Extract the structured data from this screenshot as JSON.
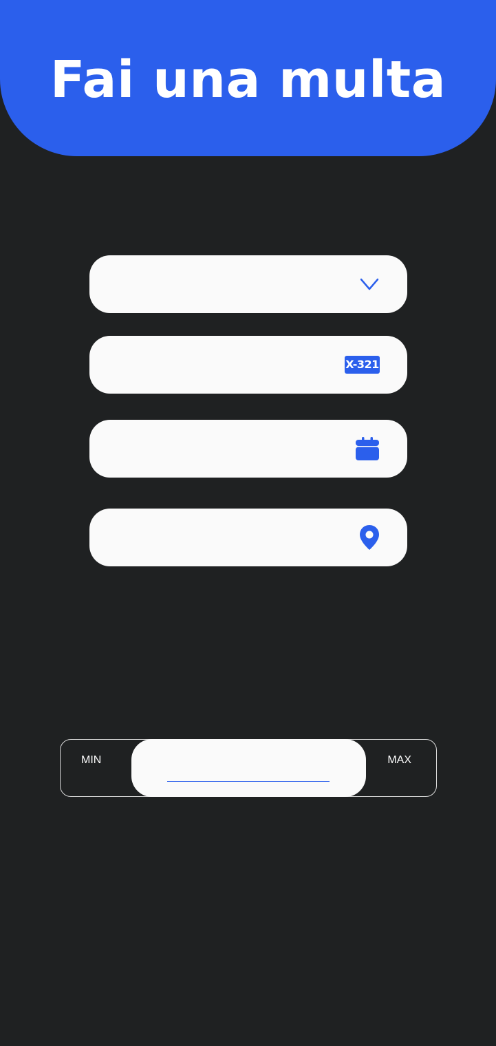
{
  "header": {
    "title": "Fai una multa"
  },
  "form": {
    "violation_type": {
      "value": "",
      "icon": "chevron-down-icon"
    },
    "plate": {
      "value": "",
      "icon": "license-plate-icon",
      "icon_text": "X-321"
    },
    "date": {
      "value": "",
      "icon": "calendar-icon"
    },
    "location": {
      "value": "",
      "icon": "map-pin-icon"
    }
  },
  "amount_range": {
    "min_label": "MIN",
    "max_label": "MAX",
    "value": ""
  },
  "colors": {
    "accent": "#2b5fec",
    "background": "#1f2122",
    "field": "#fafafa"
  }
}
